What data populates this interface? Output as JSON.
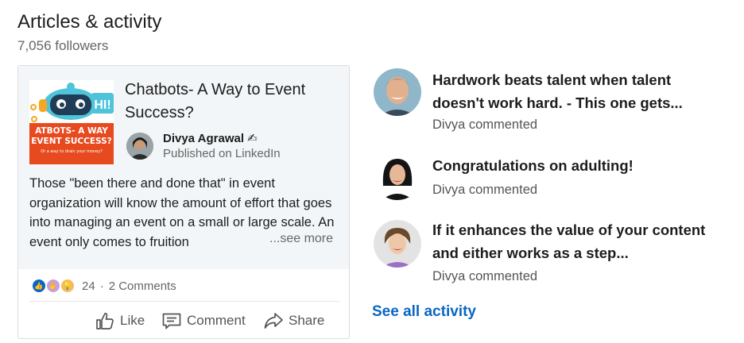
{
  "section": {
    "title": "Articles & activity",
    "followers": "7,056 followers"
  },
  "article": {
    "thumbnail": {
      "badge": "HI!",
      "banner_line1": "ATBOTS- A WAY",
      "banner_line2": "EVENT SUCCESS?",
      "banner_sub": "Or a way to drain your money?"
    },
    "title": "Chatbots- A Way to Event Success?",
    "author": "Divya Agrawal ✍",
    "published": "Published on LinkedIn",
    "excerpt": "Those \"been there and done that\" in event organization will know the amount of effort that goes into managing an event on a small or large scale. An event only comes to fruition",
    "see_more": "...see more",
    "reactions_count": "24",
    "separator": "·",
    "comments": "2 Comments",
    "actions": {
      "like": "Like",
      "comment": "Comment",
      "share": "Share"
    }
  },
  "activity": [
    {
      "title": "Hardwork beats talent when talent doesn't work hard. - This one gets...",
      "meta": "Divya commented"
    },
    {
      "title": "Congratulations on adulting!",
      "meta": "Divya commented"
    },
    {
      "title": "If it enhances the value of your content and either works as a step...",
      "meta": "Divya commented"
    }
  ],
  "see_all": "See all activity",
  "colors": {
    "link": "#0a66c2",
    "card_background": "#f3f6f8",
    "banner": "#e84a1f"
  }
}
